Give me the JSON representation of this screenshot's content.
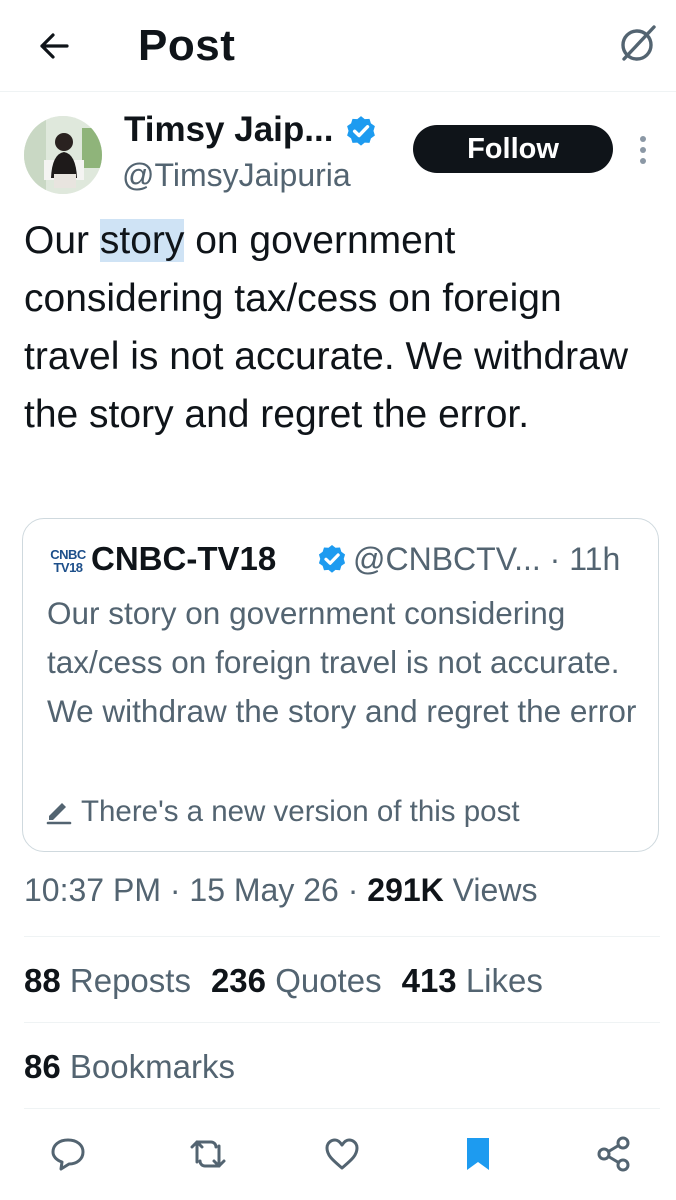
{
  "header": {
    "title": "Post",
    "back_icon": "arrow-left-icon",
    "grok_icon": "grok-icon"
  },
  "post": {
    "author": {
      "name": "Timsy Jaip...",
      "handle": "@TimsyJaipuria",
      "verified": true,
      "follow_label": "Follow"
    },
    "text_before": "Our ",
    "text_highlight": "story",
    "text_after": " on government considering tax/cess on foreign travel is not accurate. We withdraw the story and regret the error.",
    "quote": {
      "logo_top": "CNBC",
      "logo_bottom": "TV18",
      "name": "CNBC-TV18",
      "handle_time": "@CNBCTV... · 11h",
      "text": "Our story on government considering tax/cess on foreign travel is not accurate. We withdraw the story and regret the error",
      "edit_notice": "There's a new version of this post"
    },
    "meta": {
      "time": "10:37 PM",
      "sep1": " · ",
      "date": "15 May 26",
      "sep2": " · ",
      "views_count": "291K",
      "views_label": "Views"
    },
    "stats": {
      "reposts_count": "88",
      "reposts_label": "Reposts",
      "quotes_count": "236",
      "quotes_label": "Quotes",
      "likes_count": "413",
      "likes_label": "Likes",
      "bookmarks_count": "86",
      "bookmarks_label": "Bookmarks"
    }
  },
  "actions": [
    {
      "name": "reply",
      "icon": "comment-icon"
    },
    {
      "name": "repost",
      "icon": "repost-icon"
    },
    {
      "name": "like",
      "icon": "heart-icon"
    },
    {
      "name": "bookmark",
      "icon": "bookmark-filled-icon"
    },
    {
      "name": "share",
      "icon": "share-icon"
    }
  ],
  "colors": {
    "text_primary": "#0f1419",
    "text_secondary": "#536471",
    "verified_blue": "#1d9bf0",
    "highlight": "#cfe3f5",
    "border": "#cfd9de"
  }
}
